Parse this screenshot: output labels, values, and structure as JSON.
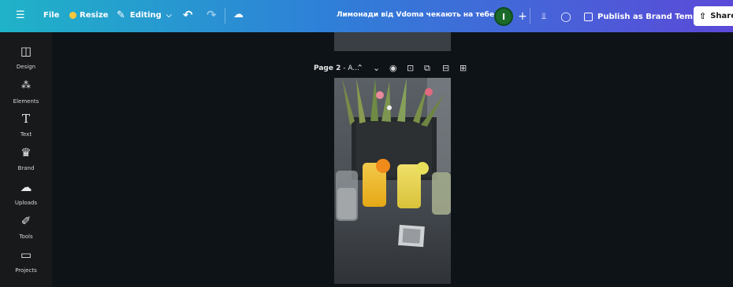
{
  "topbar": {
    "menu_icon": "hamburger-menu-icon",
    "file_label": "File",
    "resize_label": "Resize",
    "editing_label": "Editing",
    "doc_title": "Лимонади від Vdoma чекають на тебе",
    "avatar_initial": "I",
    "publish_label": "Publish as Brand Template",
    "share_label": "Share"
  },
  "sidebar": {
    "items": [
      {
        "label": "Design",
        "icon": "design-icon"
      },
      {
        "label": "Elements",
        "icon": "elements-icon"
      },
      {
        "label": "Text",
        "icon": "text-icon"
      },
      {
        "label": "Brand",
        "icon": "brand-icon"
      },
      {
        "label": "Uploads",
        "icon": "uploads-icon"
      },
      {
        "label": "Tools",
        "icon": "tools-icon"
      },
      {
        "label": "Projects",
        "icon": "projects-icon"
      }
    ]
  },
  "page": {
    "label_prefix": "Page 2",
    "label_suffix": " - A..."
  },
  "colors": {
    "topbar_start": "#1fb3c8",
    "topbar_end": "#5b4ad8",
    "sidebar_bg": "#18191b",
    "canvas_bg": "#0e1318"
  }
}
